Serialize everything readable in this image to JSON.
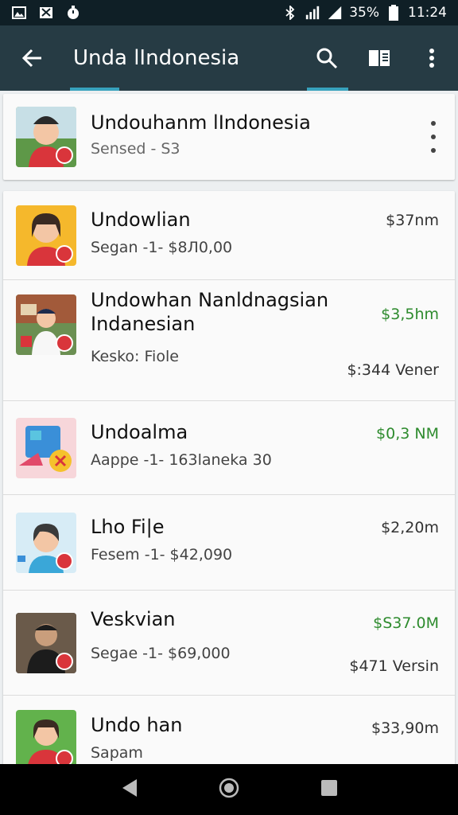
{
  "status_bar": {
    "battery": "35%",
    "time": "11:24",
    "icons": [
      "gallery-icon",
      "pictures-icon",
      "stopwatch-icon",
      "bluetooth-icon",
      "wifi-signal-icon",
      "cell-signal-icon",
      "battery-icon"
    ]
  },
  "app_bar": {
    "title": "Unda lIndonesia",
    "actions": [
      "search-icon",
      "reader-icon",
      "more-vert-icon"
    ]
  },
  "header": {
    "title": "Undouhanm lIndonesia",
    "subtitle": "Sensed - S3"
  },
  "items": [
    {
      "name": "Undowlian",
      "sub": "Segan -1- $8Л0,00",
      "price": "$37nm",
      "price_color": "#333333",
      "thumb_bg": "#f5b82c"
    },
    {
      "name": "Undowhan Nanldnagsian Indanesian",
      "sub": "Kesko: Fiole",
      "price": "$3,5hm",
      "price_color": "#2e8b2e",
      "extra": "$:344 Vener",
      "thumb_bg": "#6b8f52"
    },
    {
      "name": "Undoalma",
      "sub": "Aappe -1- 163laneka 30",
      "price": "$0,3 NM",
      "price_color": "#2e8b2e",
      "thumb_bg": "#f7d6da"
    },
    {
      "name": "Lho Fi|e",
      "sub": "Fesem -1- $42,090",
      "price": "$2,20m",
      "price_color": "#333333",
      "thumb_bg": "#d7ecf6"
    },
    {
      "name": "Veskvian",
      "sub": "Segae -1- $69,000",
      "price": "$S37.0M",
      "price_color": "#2e8b2e",
      "extra": "$471 Versin",
      "thumb_bg": "#3c3c3c"
    },
    {
      "name": "Undo han",
      "sub": "Sapam",
      "price": "$33,90m",
      "price_color": "#333333",
      "thumb_bg": "#62b24c"
    }
  ],
  "nav": [
    "back-triangle-icon",
    "home-circle-icon",
    "recents-square-icon"
  ]
}
